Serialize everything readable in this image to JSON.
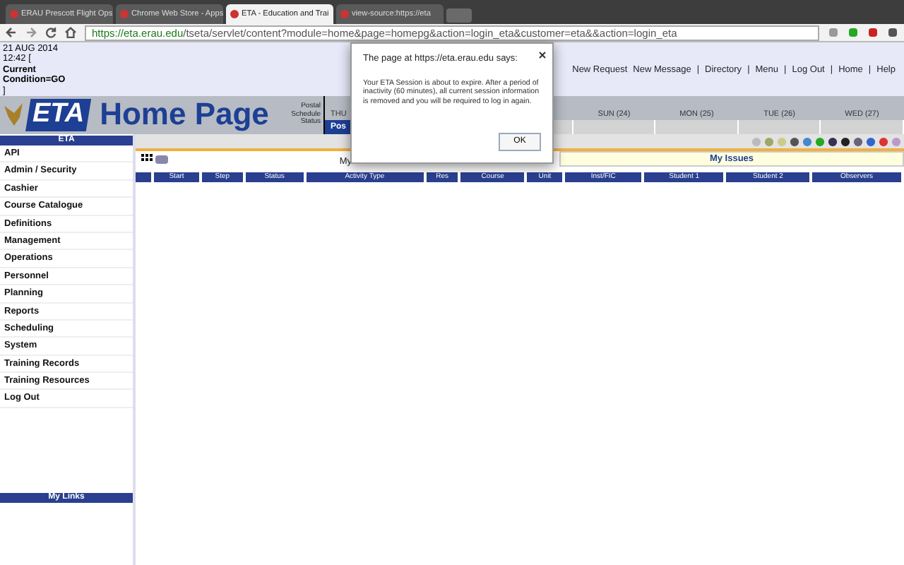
{
  "browser": {
    "tabs": [
      {
        "title": "ERAU Prescott Flight Ops",
        "selected": false
      },
      {
        "title": "Chrome Web Store - Apps",
        "selected": false
      },
      {
        "title": "ETA - Education and Trai",
        "selected": true
      },
      {
        "title": "view-source:https://eta",
        "selected": false
      }
    ],
    "url_host": "https://eta.erau.edu",
    "url_path": "/tseta/servlet/content?module=home&page=homepg&action=login_eta&customer=eta&&action=login_eta"
  },
  "status_lines": [
    "21 AUG 2014",
    "12:42 [",
    "Current",
    "Condition=GO",
    "]"
  ],
  "top_links": [
    "New Request",
    "New Message",
    "|",
    "Directory",
    "|",
    "Menu",
    "|",
    "Log Out",
    "|",
    "Home",
    "|",
    "Help"
  ],
  "header": {
    "logo": "ETA",
    "title": "Home Page",
    "legend": [
      "Postal",
      "Schedule",
      "Status"
    ],
    "post_button": "Pos",
    "days": [
      "THU",
      "SUN (24)",
      "MON (25)",
      "TUE (26)",
      "WED (27)"
    ]
  },
  "sidebar": {
    "heading": "ETA",
    "items": [
      "API",
      "Admin / Security",
      "Cashier",
      "Course Catalogue",
      "Definitions",
      "Management",
      "Operations",
      "Personnel",
      "Planning",
      "Reports",
      "Scheduling",
      "System",
      "Training Records",
      "Training Resources",
      "Log Out"
    ],
    "footer": "My Links"
  },
  "main": {
    "tab_label": "My",
    "issues": "My Issues",
    "columns": [
      "",
      "Start",
      "Step",
      "Status",
      "Activity Type",
      "Res",
      "Course",
      "Unit",
      "Inst/FIC",
      "Student 1",
      "Student 2",
      "Observers"
    ]
  },
  "dialog": {
    "title": "The page at https://eta.erau.edu says:",
    "message": "Your ETA Session is about to expire. After a period of inactivity (60 minutes), all current session information is removed and you will be required to log in again.",
    "button": "OK"
  }
}
